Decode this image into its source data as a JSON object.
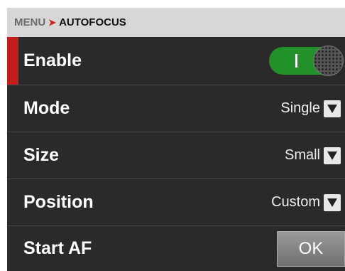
{
  "breadcrumb": {
    "root": "MENU",
    "separator": "➤",
    "current": "AUTOFOCUS"
  },
  "rows": {
    "enable": {
      "label": "Enable",
      "toggle_on": true,
      "toggle_mark": "I"
    },
    "mode": {
      "label": "Mode",
      "value": "Single"
    },
    "size": {
      "label": "Size",
      "value": "Small"
    },
    "position": {
      "label": "Position",
      "value": "Custom"
    },
    "start_af": {
      "label": "Start AF",
      "button": "OK"
    }
  },
  "colors": {
    "accent_red": "#c41d1d",
    "toggle_green": "#23912a",
    "background": "#2a2a2a"
  },
  "icons": {
    "dropdown": "chevron-down-icon"
  }
}
